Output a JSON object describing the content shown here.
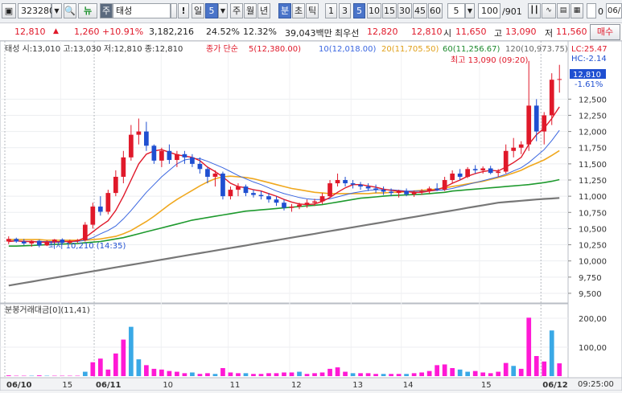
{
  "toolbar": {
    "code": "323280",
    "news": "뉴",
    "stock_badge": "주",
    "stock_name": "태성",
    "excl": "!",
    "period_tabs": [
      "일",
      "5",
      "주",
      "월",
      "년",
      "분",
      "초",
      "틱"
    ],
    "minute_options": [
      "1",
      "3",
      "5",
      "10",
      "15",
      "30",
      "45",
      "60"
    ],
    "count_value": "5",
    "page_value": "100",
    "page_total": "/901",
    "zero_label": "0",
    "right_value": "06/"
  },
  "quote": {
    "price": "12,810",
    "arrow": "▲",
    "change": "1,260",
    "change_pct": "+10.91%",
    "volume": "3,182,216",
    "turnover": "24.52%",
    "ratio": "12.32%",
    "amount": "39,043백만",
    "best_ask_label": "최우선",
    "best_ask": "12,820",
    "best_bid": "12,810",
    "open_label": "시",
    "open": "11,650",
    "high_label": "고",
    "high": "13,090",
    "low_label": "저",
    "low": "11,560",
    "buy_label": "매수"
  },
  "legend": {
    "ohlc": "태성 시:13,010 고:13,030 저:12,810 종:12,810",
    "ma_label": "종가 단순",
    "ma5": "5(12,380.00)",
    "ma10": "10(12,018.00)",
    "ma20": "20(11,705.50)",
    "ma60": "60(11,256.67)",
    "ma120": "120(10,973.75)"
  },
  "annotations": {
    "max": "최고 13,090 (09:20)",
    "min": "최저 10,210 (14:35)",
    "lc": "LC:25.47",
    "hc": "HC:-2.14",
    "cur_price": "12,810",
    "cur_pct": "-1.61%"
  },
  "volume_panel": {
    "title": "분봉거래대금[0](11,41)"
  },
  "footer": {
    "time": "09:25:00"
  },
  "colors": {
    "up": "#e0192a",
    "down": "#1f4fd1",
    "ma5": "#e0192a",
    "ma10": "#3a66e0",
    "ma20": "#f0a81e",
    "ma60": "#1e9a2e",
    "ma120": "#777777",
    "vol": "#ff19d5"
  },
  "chart_data": {
    "type": "candlestick",
    "y_ticks": [
      "12,500",
      "12,250",
      "12,000",
      "11,750",
      "11,500",
      "11,250",
      "11,000",
      "10,750",
      "10,500",
      "10,250",
      "10,000",
      "9,750",
      "9,500"
    ],
    "volume_ticks": [
      "200,00",
      "100,00"
    ],
    "x_labels": [
      "06/10",
      "15",
      "06/11",
      "10",
      "11",
      "12",
      "13",
      "14",
      "15",
      "06/12"
    ],
    "ylim": [
      9400,
      13150
    ],
    "candles": [
      [
        10300,
        10380,
        10260,
        10340
      ],
      [
        10340,
        10360,
        10280,
        10300
      ],
      [
        10300,
        10340,
        10240,
        10270
      ],
      [
        10270,
        10320,
        10220,
        10310
      ],
      [
        10310,
        10330,
        10210,
        10240
      ],
      [
        10240,
        10320,
        10230,
        10300
      ],
      [
        10300,
        10340,
        10260,
        10330
      ],
      [
        10330,
        10350,
        10250,
        10280
      ],
      [
        10280,
        10330,
        10260,
        10310
      ],
      [
        10310,
        10340,
        10280,
        10320
      ],
      [
        10320,
        10600,
        10300,
        10560
      ],
      [
        10560,
        10900,
        10500,
        10840
      ],
      [
        10840,
        11000,
        10700,
        10760
      ],
      [
        10760,
        11100,
        10720,
        11050
      ],
      [
        11050,
        11400,
        11000,
        11300
      ],
      [
        11300,
        11700,
        11200,
        11600
      ],
      [
        11600,
        12100,
        11550,
        11950
      ],
      [
        11950,
        12200,
        11800,
        12000
      ],
      [
        12000,
        12150,
        11700,
        11780
      ],
      [
        11780,
        11800,
        11500,
        11550
      ],
      [
        11550,
        11750,
        11450,
        11700
      ],
      [
        11700,
        11800,
        11500,
        11560
      ],
      [
        11560,
        11700,
        11450,
        11650
      ],
      [
        11650,
        11700,
        11500,
        11600
      ],
      [
        11600,
        11650,
        11450,
        11500
      ],
      [
        11500,
        11600,
        11350,
        11420
      ],
      [
        11420,
        11450,
        11200,
        11300
      ],
      [
        11300,
        11400,
        11150,
        11350
      ],
      [
        11350,
        11380,
        10950,
        11000
      ],
      [
        11000,
        11150,
        10950,
        11100
      ],
      [
        11100,
        11200,
        11000,
        11150
      ],
      [
        11150,
        11180,
        11000,
        11050
      ],
      [
        11050,
        11100,
        10980,
        11020
      ],
      [
        11020,
        11080,
        10950,
        11000
      ],
      [
        11000,
        11050,
        10900,
        10950
      ],
      [
        10950,
        11000,
        10850,
        10900
      ],
      [
        10900,
        10950,
        10780,
        10820
      ],
      [
        10820,
        10880,
        10760,
        10840
      ],
      [
        10840,
        10900,
        10800,
        10870
      ],
      [
        10870,
        10950,
        10820,
        10900
      ],
      [
        10900,
        10960,
        10850,
        10920
      ],
      [
        10920,
        11050,
        10880,
        11000
      ],
      [
        11000,
        11250,
        10980,
        11200
      ],
      [
        11200,
        11350,
        11150,
        11250
      ],
      [
        11250,
        11300,
        11150,
        11200
      ],
      [
        11200,
        11250,
        11120,
        11180
      ],
      [
        11180,
        11220,
        11100,
        11150
      ],
      [
        11150,
        11200,
        11080,
        11120
      ],
      [
        11120,
        11180,
        11050,
        11100
      ],
      [
        11100,
        11150,
        11020,
        11070
      ],
      [
        11070,
        11120,
        11000,
        11050
      ],
      [
        11050,
        11100,
        10980,
        11080
      ],
      [
        11080,
        11120,
        11000,
        11030
      ],
      [
        11030,
        11090,
        10990,
        11060
      ],
      [
        11060,
        11110,
        11020,
        11080
      ],
      [
        11080,
        11150,
        11040,
        11120
      ],
      [
        11120,
        11200,
        11080,
        11100
      ],
      [
        11100,
        11300,
        11080,
        11250
      ],
      [
        11250,
        11400,
        11200,
        11350
      ],
      [
        11350,
        11420,
        11250,
        11300
      ],
      [
        11300,
        11450,
        11280,
        11420
      ],
      [
        11420,
        11480,
        11350,
        11400
      ],
      [
        11400,
        11460,
        11350,
        11430
      ],
      [
        11430,
        11470,
        11340,
        11360
      ],
      [
        11360,
        11420,
        11300,
        11380
      ],
      [
        11380,
        11800,
        11350,
        11700
      ],
      [
        11700,
        11900,
        11600,
        11750
      ],
      [
        11750,
        11850,
        11650,
        11800
      ],
      [
        11800,
        13090,
        11700,
        12400
      ],
      [
        12400,
        12500,
        11850,
        12000
      ],
      [
        12000,
        12300,
        11800,
        12250
      ],
      [
        12250,
        12900,
        12100,
        12800
      ],
      [
        12800,
        13030,
        12600,
        12810
      ]
    ],
    "volumes": [
      2,
      1,
      1,
      1,
      2,
      1,
      1,
      1,
      1,
      1,
      12,
      38,
      48,
      18,
      62,
      100,
      135,
      46,
      30,
      20,
      18,
      14,
      12,
      8,
      10,
      6,
      8,
      6,
      22,
      10,
      8,
      8,
      6,
      6,
      8,
      8,
      10,
      10,
      12,
      6,
      8,
      10,
      20,
      24,
      12,
      8,
      8,
      8,
      6,
      6,
      6,
      6,
      6,
      8,
      10,
      14,
      30,
      32,
      22,
      18,
      12,
      14,
      10,
      8,
      12,
      36,
      28,
      20,
      160,
      55,
      40,
      125,
      35
    ],
    "ma5": [
      10300,
      10310,
      10300,
      10300,
      10290,
      10290,
      10290,
      10300,
      10300,
      10310,
      10360,
      10450,
      10540,
      10620,
      10780,
      11000,
      11250,
      11500,
      11650,
      11700,
      11720,
      11680,
      11640,
      11620,
      11600,
      11550,
      11450,
      11380,
      11300,
      11200,
      11150,
      11130,
      11100,
      11080,
      11040,
      11000,
      10950,
      10910,
      10880,
      10870,
      10880,
      10920,
      10980,
      11060,
      11130,
      11180,
      11180,
      11160,
      11140,
      11110,
      11090,
      11080,
      11070,
      11060,
      11060,
      11080,
      11100,
      11140,
      11200,
      11250,
      11310,
      11350,
      11380,
      11400,
      11390,
      11450,
      11520,
      11600,
      11800,
      11950,
      12050,
      12200,
      12380
    ],
    "ma10": [
      10310,
      10310,
      10305,
      10300,
      10300,
      10300,
      10300,
      10300,
      10300,
      10300,
      10320,
      10360,
      10420,
      10470,
      10540,
      10650,
      10780,
      10920,
      11060,
      11180,
      11300,
      11400,
      11500,
      11560,
      11580,
      11580,
      11540,
      11490,
      11440,
      11380,
      11320,
      11270,
      11220,
      11180,
      11130,
      11080,
      11040,
      11010,
      10980,
      10960,
      10950,
      10950,
      10960,
      10990,
      11020,
      11050,
      11070,
      11090,
      11100,
      11100,
      11100,
      11090,
      11080,
      11080,
      11080,
      11080,
      11090,
      11100,
      11120,
      11150,
      11180,
      11210,
      11240,
      11270,
      11300,
      11340,
      11390,
      11440,
      11520,
      11620,
      11720,
      11860,
      12018
    ],
    "ma20": [
      10330,
      10330,
      10330,
      10330,
      10330,
      10320,
      10320,
      10320,
      10320,
      10320,
      10320,
      10330,
      10340,
      10360,
      10380,
      10420,
      10470,
      10540,
      10610,
      10690,
      10780,
      10870,
      10950,
      11020,
      11090,
      11160,
      11220,
      11270,
      11300,
      11310,
      11300,
      11290,
      11270,
      11240,
      11210,
      11180,
      11150,
      11120,
      11100,
      11080,
      11060,
      11050,
      11040,
      11040,
      11040,
      11040,
      11040,
      11040,
      11050,
      11050,
      11060,
      11060,
      11070,
      11080,
      11090,
      11100,
      11110,
      11130,
      11150,
      11170,
      11190,
      11210,
      11230,
      11260,
      11290,
      11320,
      11360,
      11400,
      11460,
      11510,
      11560,
      11630,
      11705
    ],
    "ma60": [
      10230,
      10230,
      10235,
      10240,
      10245,
      10250,
      10255,
      10260,
      10265,
      10270,
      10280,
      10290,
      10300,
      10320,
      10340,
      10360,
      10390,
      10420,
      10450,
      10480,
      10510,
      10540,
      10570,
      10600,
      10630,
      10650,
      10670,
      10690,
      10710,
      10730,
      10750,
      10770,
      10780,
      10790,
      10800,
      10810,
      10820,
      10830,
      10840,
      10850,
      10860,
      10870,
      10890,
      10910,
      10930,
      10950,
      10970,
      10980,
      10990,
      11000,
      11010,
      11015,
      11020,
      11025,
      11030,
      11040,
      11050,
      11060,
      11080,
      11090,
      11100,
      11110,
      11120,
      11130,
      11140,
      11150,
      11160,
      11170,
      11180,
      11195,
      11210,
      11230,
      11256
    ],
    "ma120": [
      9620,
      9640,
      9660,
      9680,
      9700,
      9720,
      9740,
      9760,
      9780,
      9800,
      9820,
      9840,
      9860,
      9880,
      9900,
      9920,
      9940,
      9960,
      9980,
      10000,
      10020,
      10040,
      10060,
      10080,
      10100,
      10120,
      10140,
      10160,
      10180,
      10200,
      10220,
      10240,
      10260,
      10280,
      10300,
      10320,
      10340,
      10360,
      10380,
      10400,
      10420,
      10440,
      10460,
      10480,
      10500,
      10520,
      10540,
      10560,
      10580,
      10600,
      10620,
      10640,
      10660,
      10680,
      10700,
      10720,
      10740,
      10760,
      10780,
      10800,
      10820,
      10840,
      10860,
      10880,
      10900,
      10910,
      10920,
      10930,
      10940,
      10950,
      10958,
      10965,
      10973
    ]
  }
}
